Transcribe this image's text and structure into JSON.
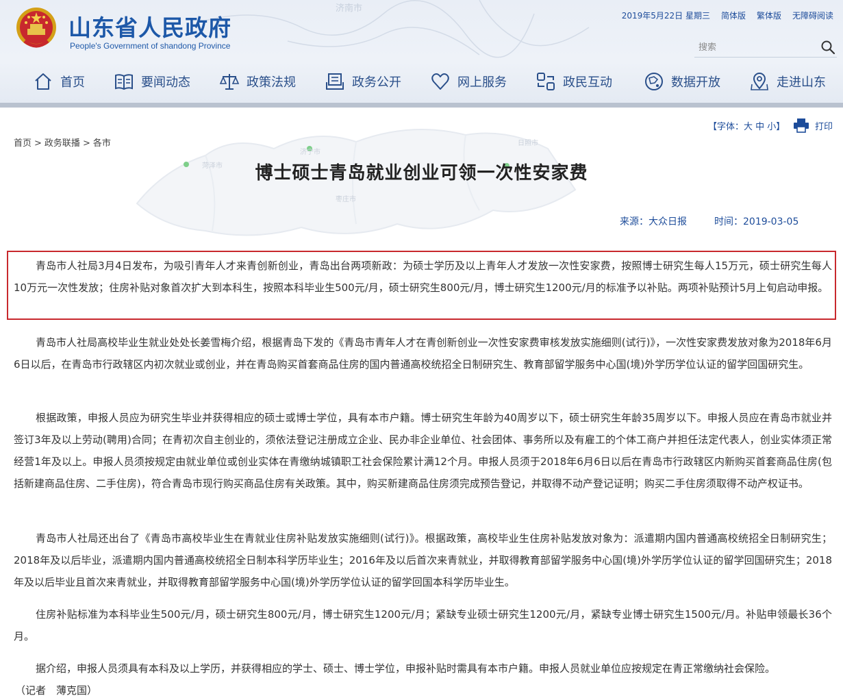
{
  "header": {
    "site_title": "山东省人民政府",
    "site_subtitle": "People's Government of shandong Province",
    "date": "2019年5月22日 星期三",
    "links": [
      "简体版",
      "繁体版",
      "无障碍阅读"
    ],
    "search_placeholder": "搜索",
    "map_labels": [
      "济南市"
    ],
    "colors": {
      "brand": "#1d58a8",
      "nav_text": "#2a4f8a",
      "header_bg": "#e9eef6"
    }
  },
  "nav": {
    "items": [
      {
        "label": "首页",
        "icon": "home-icon"
      },
      {
        "label": "要闻动态",
        "icon": "news-icon"
      },
      {
        "label": "政策法规",
        "icon": "scales-icon"
      },
      {
        "label": "政务公开",
        "icon": "open-affairs-icon"
      },
      {
        "label": "网上服务",
        "icon": "heart-icon"
      },
      {
        "label": "政民互动",
        "icon": "interaction-icon"
      },
      {
        "label": "数据开放",
        "icon": "globe-icon"
      },
      {
        "label": "走进山东",
        "icon": "location-icon"
      }
    ]
  },
  "tools": {
    "font_size": "【字体：大 中 小】",
    "print": "打印"
  },
  "breadcrumb": [
    "首页",
    "政务联播",
    "各市"
  ],
  "breadcrumb_sep": ">",
  "bg_map_labels": [
    "济宁市",
    "菏泽市",
    "枣庄市",
    "日照市"
  ],
  "article": {
    "title": "博士硕士青岛就业创业可领一次性安家费",
    "source": "来源：大众日报",
    "time": "时间：2019-03-05",
    "highlight_color": "#c8282d",
    "paragraphs": [
      "青岛市人社局3月4日发布，为吸引青年人才来青创新创业，青岛出台两项新政：为硕士学历及以上青年人才发放一次性安家费，按照博士研究生每人15万元，硕士研究生每人10万元一次性发放；住房补贴对象首次扩大到本科生，按照本科毕业生500元/月，硕士研究生800元/月，博士研究生1200元/月的标准予以补贴。两项补贴预计5月上旬启动申报。",
      "青岛市人社局高校毕业生就业处处长姜雪梅介绍，根据青岛下发的《青岛市青年人才在青创新创业一次性安家费审核发放实施细则(试行)》，一次性安家费发放对象为2018年6月6日以后，在青岛市行政辖区内初次就业或创业，并在青岛购买首套商品住房的国内普通高校统招全日制研究生、教育部留学服务中心国(境)外学历学位认证的留学回国研究生。",
      "根据政策，申报人员应为研究生毕业并获得相应的硕士或博士学位，具有本市户籍。博士研究生年龄为40周岁以下，硕士研究生年龄35周岁以下。申报人员应在青岛市就业并签订3年及以上劳动(聘用)合同；在青初次自主创业的，须依法登记注册成立企业、民办非企业单位、社会团体、事务所以及有雇工的个体工商户并担任法定代表人，创业实体须正常经营1年及以上。申报人员须按规定由就业单位或创业实体在青缴纳城镇职工社会保险累计满12个月。申报人员须于2018年6月6日以后在青岛市行政辖区内新购买首套商品住房(包括新建商品住房、二手住房)，符合青岛市现行购买商品住房有关政策。其中，购买新建商品住房须完成预告登记，并取得不动产登记证明；购买二手住房须取得不动产权证书。",
      "青岛市人社局还出台了《青岛市高校毕业生在青就业住房补贴发放实施细则(试行)》。根据政策，高校毕业生住房补贴发放对象为：派遣期内国内普通高校统招全日制研究生；2018年及以后毕业，派遣期内国内普通高校统招全日制本科学历毕业生；2016年及以后首次来青就业，并取得教育部留学服务中心国(境)外学历学位认证的留学回国研究生；2018年及以后毕业且首次来青就业，并取得教育部留学服务中心国(境)外学历学位认证的留学回国本科学历毕业生。",
      "住房补贴标准为本科毕业生500元/月，硕士研究生800元/月，博士研究生1200元/月；紧缺专业硕士研究生1200元/月，紧缺专业博士研究生1500元/月。补贴申领最长36个月。",
      "据介绍，申报人员须具有本科及以上学历，并获得相应的学士、硕士、博士学位，申报补贴时需具有本市户籍。申报人员就业单位应按规定在青正常缴纳社会保险。"
    ],
    "reporter": "（记者　薄克国）"
  }
}
